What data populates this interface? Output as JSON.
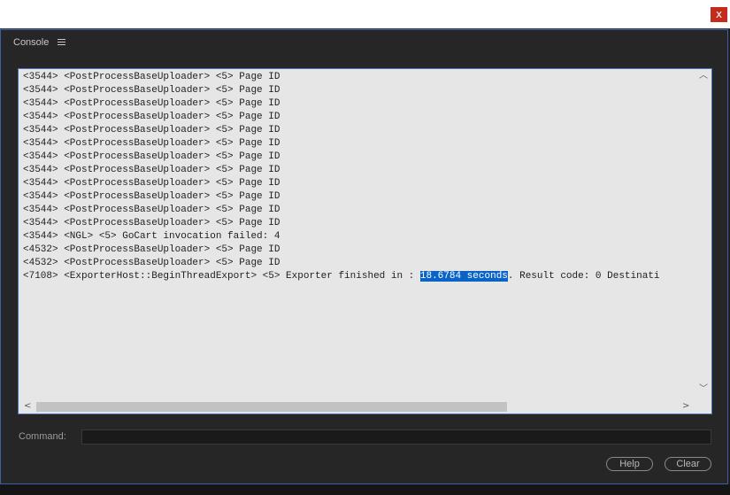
{
  "window": {
    "close_glyph": "x",
    "panel_title": "Console",
    "menu_icon": "hamburger-menu-icon"
  },
  "console": {
    "lines": [
      {
        "text": "<3544> <PostProcessBaseUploader> <5> Page ID"
      },
      {
        "text": "<3544> <PostProcessBaseUploader> <5> Page ID"
      },
      {
        "text": "<3544> <PostProcessBaseUploader> <5> Page ID"
      },
      {
        "text": "<3544> <PostProcessBaseUploader> <5> Page ID"
      },
      {
        "text": "<3544> <PostProcessBaseUploader> <5> Page ID"
      },
      {
        "text": "<3544> <PostProcessBaseUploader> <5> Page ID"
      },
      {
        "text": "<3544> <PostProcessBaseUploader> <5> Page ID"
      },
      {
        "text": "<3544> <PostProcessBaseUploader> <5> Page ID"
      },
      {
        "text": "<3544> <PostProcessBaseUploader> <5> Page ID"
      },
      {
        "text": "<3544> <PostProcessBaseUploader> <5> Page ID"
      },
      {
        "text": "<3544> <PostProcessBaseUploader> <5> Page ID"
      },
      {
        "text": "<3544> <PostProcessBaseUploader> <5> Page ID"
      },
      {
        "text": "<3544> <NGL> <5> GoCart invocation failed: 4"
      },
      {
        "text": "<4532> <PostProcessBaseUploader> <5> Page ID"
      },
      {
        "text": "<4532> <PostProcessBaseUploader> <5> Page ID"
      }
    ],
    "last_line": {
      "before": "<7108> <ExporterHost::BeginThreadExport> <5> Exporter finished in : ",
      "selected": "18.6784 seconds",
      "after": ". Result code: 0 Destinati"
    },
    "scroll_up_glyph": "︿",
    "scroll_down_glyph": "﹀",
    "scroll_left_glyph": "<",
    "scroll_right_glyph": ">"
  },
  "command": {
    "label": "Command:",
    "value": "",
    "placeholder": ""
  },
  "buttons": {
    "help": "Help",
    "clear": "Clear"
  }
}
